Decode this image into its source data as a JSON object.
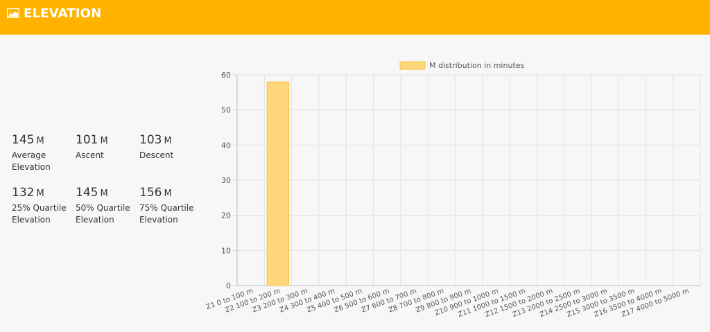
{
  "header": {
    "title": "ELEVATION",
    "icon": "area-chart-icon",
    "color": "#ffb300"
  },
  "stats": [
    {
      "value": "145",
      "unit": "M",
      "label": "Average Elevation"
    },
    {
      "value": "101",
      "unit": "M",
      "label": "Ascent"
    },
    {
      "value": "103",
      "unit": "M",
      "label": "Descent"
    },
    {
      "value": "132",
      "unit": "M",
      "label": "25% Quartile Elevation"
    },
    {
      "value": "145",
      "unit": "M",
      "label": "50% Quartile Elevation"
    },
    {
      "value": "156",
      "unit": "M",
      "label": "75% Quartile Elevation"
    }
  ],
  "chart_data": {
    "type": "bar",
    "categories": [
      "Z1 0 to 100 m",
      "Z2 100 to 200 m",
      "Z3 200 to 300 m",
      "Z4 300 to 400 m",
      "Z5 400 to 500 m",
      "Z6 500 to 600 m",
      "Z7 600 to 700 m",
      "Z8 700 to 800 m",
      "Z9 800 to 900 m",
      "Z10 900 to 1000 m",
      "Z11 1000 to 1500 m",
      "Z12 1500 to 2000 m",
      "Z13 2000 to 2500 m",
      "Z14 2500 to 3000 m",
      "Z15 3000 to 3500 m",
      "Z16 3500 to 4000 m",
      "Z17 4000 to 5000 m"
    ],
    "series": [
      {
        "name": "M distribution in minutes",
        "values": [
          0,
          58,
          0,
          0,
          0,
          0,
          0,
          0,
          0,
          0,
          0,
          0,
          0,
          0,
          0,
          0,
          0
        ],
        "color": "#ffd77a",
        "border": "#f6c143"
      }
    ],
    "yticks": [
      0,
      10,
      20,
      30,
      40,
      50,
      60
    ],
    "ylim": [
      0,
      60
    ],
    "grid": true,
    "legend": "top"
  }
}
